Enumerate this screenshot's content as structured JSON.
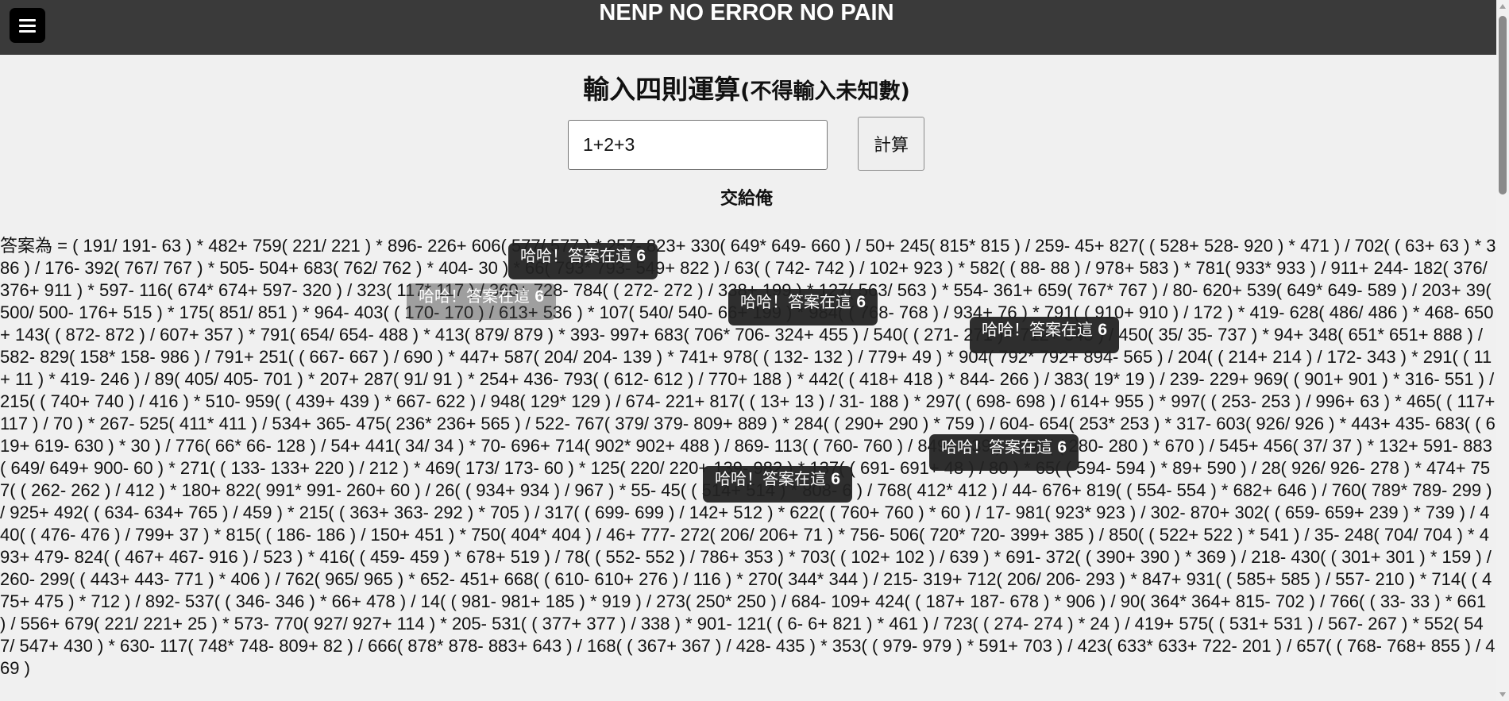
{
  "header": {
    "menu_icon": "hamburger-icon",
    "title": "NENP NO ERROR NO PAIN",
    "background": "#3a3a3a"
  },
  "form": {
    "heading": "輸入四則運算",
    "heading_note": "(不得輸入未知數)",
    "input_value": "1+2+3",
    "calculate_label": "計算",
    "submit_text": "交給俺"
  },
  "answer": {
    "text": "答案為 = ( 191/ 191- 63 ) * 482+ 759( 221/ 221 ) * 896- 226+ 606( 577/ 577 ) * 257- 823+ 330( 649* 649- 660 ) / 50+ 245( 815* 815 ) / 259- 45+ 827( ( 528+ 528- 920 ) * 471 ) / 702( ( 63+ 63 ) * 386 ) / 176- 392( 767/ 767 ) * 505- 504+ 683( 762/ 762 ) * 404- 30 ) * 66( 793* 793- 549+ 822 ) / 63( ( 742- 742 ) / 102+ 923 ) * 582( ( 88- 88 ) / 978+ 583 ) * 781( 933* 933 ) / 911+ 244- 182( 376/ 376+ 911 ) * 597- 116( 674* 674+ 597- 320 ) / 323( 117* 117 ) / 360+ 728- 784( ( 272- 272 ) / 338+ 199 ) * 127( 563/ 563 ) * 554- 361+ 659( 767* 767 ) / 80- 620+ 539( 649* 649- 589 ) / 203+ 39( 500/ 500- 176+ 515 ) * 175( 851/ 851 ) * 964- 403( ( 170- 170 ) / 613+ 536 ) * 107( 540/ 540- 66+ 199 ) * 984( ( 768- 768 ) / 934+ 76 ) * 791( ( 910+ 910 ) / 172 ) * 419- 628( 486/ 486 ) * 468- 650+ 143( ( 872- 872 ) / 607+ 357 ) * 791( 654/ 654- 488 ) * 413( 879/ 879 ) * 393- 997+ 683( 706* 706- 324+ 455 ) / 540( ( 271- 271 ) * 712+ 348 ) / 450( 35/ 35- 737 ) * 94+ 348( 651* 651+ 888 ) / 582- 829( 158* 158- 986 ) / 791+ 251( ( 667- 667 ) / 690 ) * 447+ 587( 204/ 204- 139 ) * 741+ 978( ( 132- 132 ) / 779+ 49 ) * 904( 792* 792+ 894- 565 ) / 204( ( 214+ 214 ) / 172- 343 ) * 291( ( 11+ 11 ) * 419- 246 ) / 89( 405/ 405- 701 ) * 207+ 287( 91/ 91 ) * 254+ 436- 793( ( 612- 612 ) / 770+ 188 ) * 442( ( 418+ 418 ) * 844- 266 ) / 383( 19* 19 ) / 239- 229+ 969( ( 901+ 901 ) * 316- 551 ) / 215( ( 740+ 740 ) / 416 ) * 510- 959( ( 439+ 439 ) * 667- 622 ) / 948( 129* 129 ) / 674- 221+ 817( ( 13+ 13 ) / 31- 188 ) * 297( ( 698- 698 ) / 614+ 955 ) * 997( ( 253- 253 ) / 996+ 63 ) * 465( ( 117+ 117 ) / 70 ) * 267- 525( 411* 411 ) / 534+ 365- 475( 236* 236+ 565 ) / 522- 767( 379/ 379- 809+ 889 ) * 284( ( 290+ 290 ) * 759 ) / 604- 654( 253* 253 ) * 317- 603( 926/ 926 ) * 443+ 435- 683( ( 619+ 619- 630 ) * 30 ) / 776( 66* 66- 128 ) / 54+ 441( 34/ 34 ) * 70- 696+ 714( 902* 902+ 488 ) / 869- 113( ( 760- 760 ) / 849+ 139 ) * 299( ( 280- 280 ) * 670 ) / 545+ 456( 37/ 37 ) * 132+ 591- 883( 649/ 649+ 900- 60 ) * 271( ( 133- 133+ 220 ) / 212 ) * 469( 173/ 173- 60 ) * 125( 220/ 220+ 139- 982 ) * 137( ( 691- 691+ 48 ) / 80 ) * 65( ( 594- 594 ) * 89+ 590 ) / 28( 926/ 926- 278 ) * 474+ 757( ( 262- 262 ) / 412 ) * 180+ 822( 991* 991- 260+ 60 ) / 26( ( 934+ 934 ) / 967 ) * 55- 45( ( 514+ 514 ) * 808- 6 ) / 768( 412* 412 ) / 44- 676+ 819( ( 554- 554 ) * 682+ 646 ) / 760( 789* 789- 299 ) / 925+ 492( ( 634- 634+ 765 ) / 459 ) * 215( ( 363+ 363- 292 ) * 705 ) / 317( ( 699- 699 ) / 142+ 512 ) * 622( ( 760+ 760 ) * 60 ) / 17- 981( 923* 923 ) / 302- 870+ 302( ( 659- 659+ 239 ) * 739 ) / 440( ( 476- 476 ) / 799+ 37 ) * 815( ( 186- 186 ) / 150+ 451 ) * 750( 404* 404 ) / 46+ 777- 272( 206/ 206+ 71 ) * 756- 506( 720* 720- 399+ 385 ) / 850( ( 522+ 522 ) * 541 ) / 35- 248( 704/ 704 ) * 493+ 479- 824( ( 467+ 467- 916 ) / 523 ) * 416( ( 459- 459 ) * 678+ 519 ) / 78( ( 552- 552 ) / 786+ 353 ) * 703( ( 102+ 102 ) / 639 ) * 691- 372( ( 390+ 390 ) * 369 ) / 218- 430( ( 301+ 301 ) * 159 ) / 260- 299( ( 443+ 443- 771 ) * 406 ) / 762( 965/ 965 ) * 652- 451+ 668( ( 610- 610+ 276 ) / 116 ) * 270( 344* 344 ) / 215- 319+ 712( 206/ 206- 293 ) * 847+ 931( ( 585+ 585 ) / 557- 210 ) * 714( ( 475+ 475 ) * 712 ) / 892- 537( ( 346- 346 ) * 66+ 478 ) / 14( ( 981- 981+ 185 ) * 919 ) / 273( 250* 250 ) / 684- 109+ 424( ( 187+ 187- 678 ) * 906 ) / 90( 364* 364+ 815- 702 ) / 766( ( 33- 33 ) * 661 ) / 556+ 679( 221/ 221+ 25 ) * 573- 770( 927/ 927+ 114 ) * 205- 531( ( 377+ 377 ) / 338 ) * 901- 121( ( 6- 6+ 821 ) * 461 ) / 723( ( 274- 274 ) * 24 ) / 419+ 575( ( 531+ 531 ) / 567- 267 ) * 552( 547/ 547+ 430 ) * 630- 117( 748* 748- 809+ 82 ) / 666( 878* 878- 883+ 643 ) / 168( ( 367+ 367 ) / 428- 435 ) * 353( ( 979- 979 ) * 591+ 703 ) / 423( 633* 633+ 722- 201 ) / 657( ( 768- 768+ 855 ) / 469 )"
  },
  "toasts": [
    {
      "text": "哈哈！答案在這",
      "value": "6"
    },
    {
      "text": "哈哈！答案在這",
      "value": "6"
    },
    {
      "text": "哈哈！答案在這",
      "value": "6"
    },
    {
      "text": "哈哈！答案在這",
      "value": "6"
    },
    {
      "text": "哈哈！答案在這",
      "value": "6"
    },
    {
      "text": "哈哈！答案在這",
      "value": "6"
    }
  ]
}
